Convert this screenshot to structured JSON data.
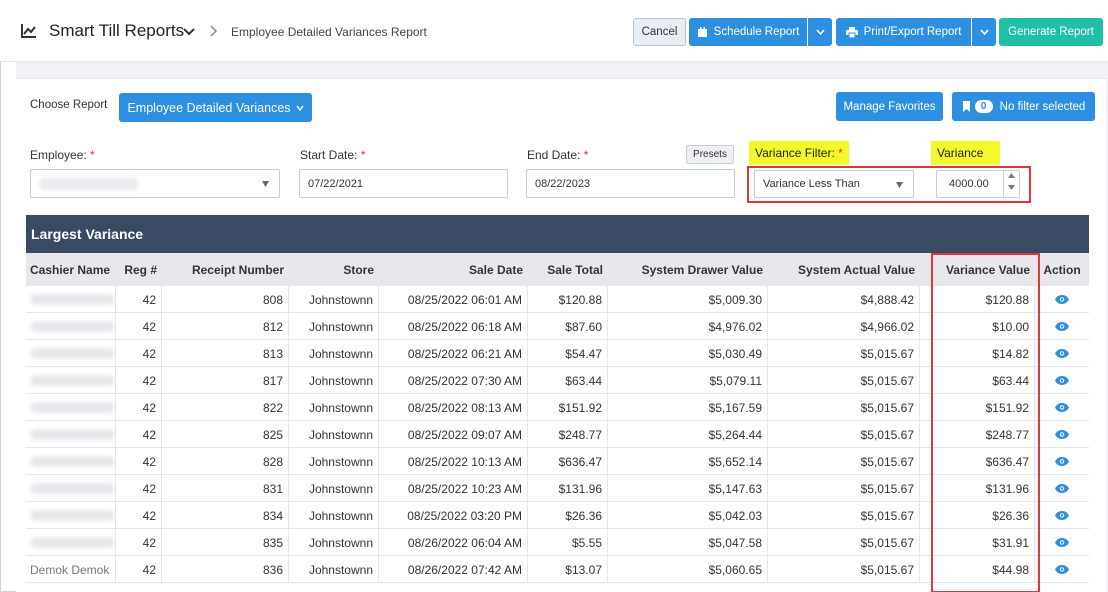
{
  "header": {
    "app_title": "Smart Till Reports",
    "breadcrumb": "Employee Detailed Variances Report",
    "cancel_label": "Cancel",
    "schedule_label": "Schedule Report",
    "print_label": "Print/Export Report",
    "generate_label": "Generate Report",
    "accent_blue": "#2d8fe0",
    "accent_green": "#1fbfa8"
  },
  "toolbar": {
    "choose_report_label": "Choose Report",
    "report_selected": "Employee Detailed Variances",
    "manage_favorites_label": "Manage Favorites",
    "filter_count": "0",
    "filter_label": "No filter selected"
  },
  "filters": {
    "employee_label": "Employee:",
    "start_date_label": "Start Date:",
    "start_date_value": "07/22/2021",
    "end_date_label": "End Date:",
    "end_date_value": "08/22/2023",
    "presets_label": "Presets",
    "variance_filter_label": "Variance Filter:",
    "variance_filter_value": "Variance Less Than",
    "variance_label": "Variance",
    "variance_value": "4000.00",
    "required_mark": "*"
  },
  "table": {
    "title": "Largest Variance",
    "columns": [
      "Cashier Name",
      "Reg #",
      "Receipt Number",
      "Store",
      "Sale Date",
      "Sale Total",
      "System Drawer Value",
      "System Actual Value",
      "Variance Value",
      "Action"
    ],
    "rows": [
      {
        "cashier": "",
        "reg": "42",
        "receipt": "808",
        "store": "Johnstownn",
        "date": "08/25/2022 06:01 AM",
        "total": "$120.88",
        "drawer": "$5,009.30",
        "actual": "$4,888.42",
        "variance": "$120.88"
      },
      {
        "cashier": "",
        "reg": "42",
        "receipt": "812",
        "store": "Johnstownn",
        "date": "08/25/2022 06:18 AM",
        "total": "$87.60",
        "drawer": "$4,976.02",
        "actual": "$4,966.02",
        "variance": "$10.00"
      },
      {
        "cashier": "",
        "reg": "42",
        "receipt": "813",
        "store": "Johnstownn",
        "date": "08/25/2022 06:21 AM",
        "total": "$54.47",
        "drawer": "$5,030.49",
        "actual": "$5,015.67",
        "variance": "$14.82"
      },
      {
        "cashier": "",
        "reg": "42",
        "receipt": "817",
        "store": "Johnstownn",
        "date": "08/25/2022 07:30 AM",
        "total": "$63.44",
        "drawer": "$5,079.11",
        "actual": "$5,015.67",
        "variance": "$63.44"
      },
      {
        "cashier": "",
        "reg": "42",
        "receipt": "822",
        "store": "Johnstownn",
        "date": "08/25/2022 08:13 AM",
        "total": "$151.92",
        "drawer": "$5,167.59",
        "actual": "$5,015.67",
        "variance": "$151.92"
      },
      {
        "cashier": "",
        "reg": "42",
        "receipt": "825",
        "store": "Johnstownn",
        "date": "08/25/2022 09:07 AM",
        "total": "$248.77",
        "drawer": "$5,264.44",
        "actual": "$5,015.67",
        "variance": "$248.77"
      },
      {
        "cashier": "",
        "reg": "42",
        "receipt": "828",
        "store": "Johnstownn",
        "date": "08/25/2022 10:13 AM",
        "total": "$636.47",
        "drawer": "$5,652.14",
        "actual": "$5,015.67",
        "variance": "$636.47"
      },
      {
        "cashier": "",
        "reg": "42",
        "receipt": "831",
        "store": "Johnstownn",
        "date": "08/25/2022 10:23 AM",
        "total": "$131.96",
        "drawer": "$5,147.63",
        "actual": "$5,015.67",
        "variance": "$131.96"
      },
      {
        "cashier": "",
        "reg": "42",
        "receipt": "834",
        "store": "Johnstownn",
        "date": "08/25/2022 03:20 PM",
        "total": "$26.36",
        "drawer": "$5,042.03",
        "actual": "$5,015.67",
        "variance": "$26.36"
      },
      {
        "cashier": "",
        "reg": "42",
        "receipt": "835",
        "store": "Johnstownn",
        "date": "08/26/2022 06:04 AM",
        "total": "$5.55",
        "drawer": "$5,047.58",
        "actual": "$5,015.67",
        "variance": "$31.91"
      },
      {
        "cashier": "Demok Demok",
        "reg": "42",
        "receipt": "836",
        "store": "Johnstownn",
        "date": "08/26/2022 07:42 AM",
        "total": "$13.07",
        "drawer": "$5,060.65",
        "actual": "$5,015.67",
        "variance": "$44.98"
      }
    ],
    "action_icon": "eye-icon"
  }
}
